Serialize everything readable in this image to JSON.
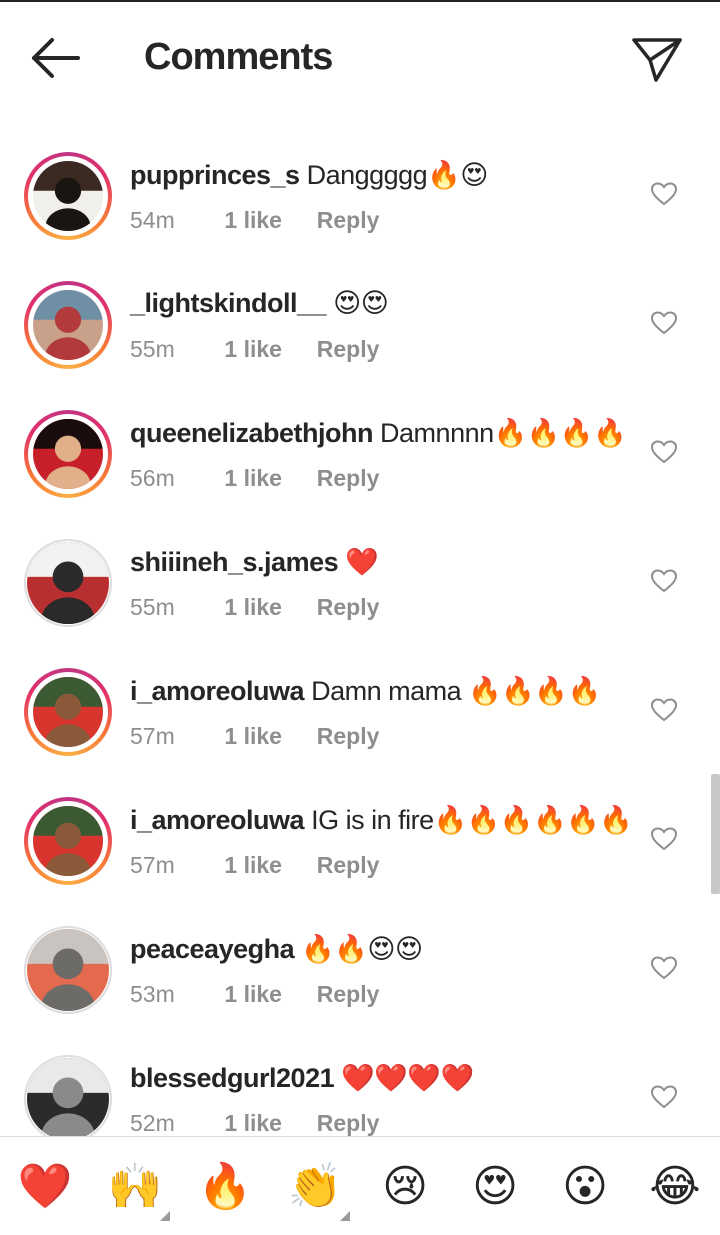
{
  "header": {
    "title": "Comments",
    "back_icon": "arrow-left-icon",
    "send_icon": "paper-plane-icon"
  },
  "comments": [
    {
      "username": "pupprinces_s",
      "text": "Danggggg🔥😍",
      "time": "54m",
      "likes": "1 like",
      "reply": "Reply",
      "story_ring": true
    },
    {
      "username": "_lightskindoll__",
      "text": "😍😍",
      "time": "55m",
      "likes": "1 like",
      "reply": "Reply",
      "story_ring": true
    },
    {
      "username": "queenelizabethjohn",
      "text": "Damnnnn🔥🔥🔥🔥",
      "time": "56m",
      "likes": "1 like",
      "reply": "Reply",
      "story_ring": true
    },
    {
      "username": "shiiineh_s.james",
      "text": "❤️",
      "time": "55m",
      "likes": "1 like",
      "reply": "Reply",
      "story_ring": false
    },
    {
      "username": "i_amoreoluwa",
      "text": "Damn mama 🔥🔥🔥🔥",
      "time": "57m",
      "likes": "1 like",
      "reply": "Reply",
      "story_ring": true
    },
    {
      "username": "i_amoreoluwa",
      "text": "IG is in fire🔥🔥🔥🔥🔥🔥",
      "time": "57m",
      "likes": "1 like",
      "reply": "Reply",
      "story_ring": true
    },
    {
      "username": "peaceayegha",
      "text": "🔥🔥😍😍",
      "time": "53m",
      "likes": "1 like",
      "reply": "Reply",
      "story_ring": false
    },
    {
      "username": "blessedgurl2021",
      "text": "❤️❤️❤️❤️",
      "time": "52m",
      "likes": "1 like",
      "reply": "Reply",
      "story_ring": false
    }
  ],
  "emoji_tray": [
    "❤️",
    "🙌",
    "🔥",
    "👏",
    "😢",
    "😍",
    "😮",
    "😂"
  ],
  "colors": {
    "text": "#262626",
    "meta": "#8e8e8e",
    "ring_start": "#c13584",
    "ring_end": "#fcaf45"
  }
}
